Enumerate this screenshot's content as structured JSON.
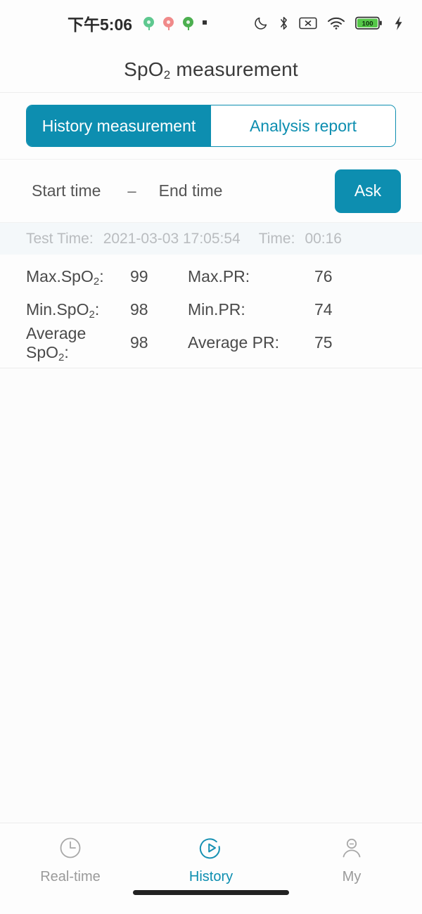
{
  "status_bar": {
    "clock": "下午5:06",
    "notification_icons": [
      "app-notification-green-icon",
      "app-notification-red-icon",
      "app-notification-green2-icon",
      "notification-dot-icon"
    ],
    "right_icons": [
      "do-not-disturb-moon-icon",
      "bluetooth-icon",
      "mute-box-icon",
      "wifi-icon",
      "battery-icon",
      "charging-bolt-icon"
    ],
    "battery_level": "100",
    "battery_color": "#4caf50"
  },
  "header": {
    "title_main": "SpO",
    "title_sub": "2",
    "title_tail": " measurement"
  },
  "tabs": {
    "items": [
      {
        "label": "History measurement",
        "active": true
      },
      {
        "label": "Analysis report",
        "active": false
      }
    ],
    "accent_color": "#0d8eb0"
  },
  "filter": {
    "start_time_placeholder": "Start time",
    "end_time_placeholder": "End time",
    "separator": "–",
    "ask_label": "Ask"
  },
  "record": {
    "test_time_label": "Test Time:",
    "test_time_value": "2021-03-03 17:05:54",
    "duration_label": "Time:",
    "duration_value": "00:16",
    "rows": [
      {
        "label_left": "Max.SpO",
        "sub_left": "2",
        "colon_left": ":",
        "value_left": "99",
        "label_right": "Max.PR:",
        "value_right": "76"
      },
      {
        "label_left": "Min.SpO",
        "sub_left": "2",
        "colon_left": ":",
        "value_left": "98",
        "label_right": "Min.PR:",
        "value_right": "74"
      },
      {
        "label_left": "Average SpO",
        "sub_left": "2",
        "colon_left": ":",
        "value_left": "98",
        "label_right": "Average PR:",
        "value_right": "75"
      }
    ]
  },
  "bottom_nav": {
    "items": [
      {
        "label": "Real-time",
        "icon": "clock-icon",
        "active": false
      },
      {
        "label": "History",
        "icon": "history-replay-icon",
        "active": true
      },
      {
        "label": "My",
        "icon": "person-icon",
        "active": false
      }
    ],
    "active_color": "#0d8eb0",
    "inactive_color": "#9a9a9a"
  }
}
